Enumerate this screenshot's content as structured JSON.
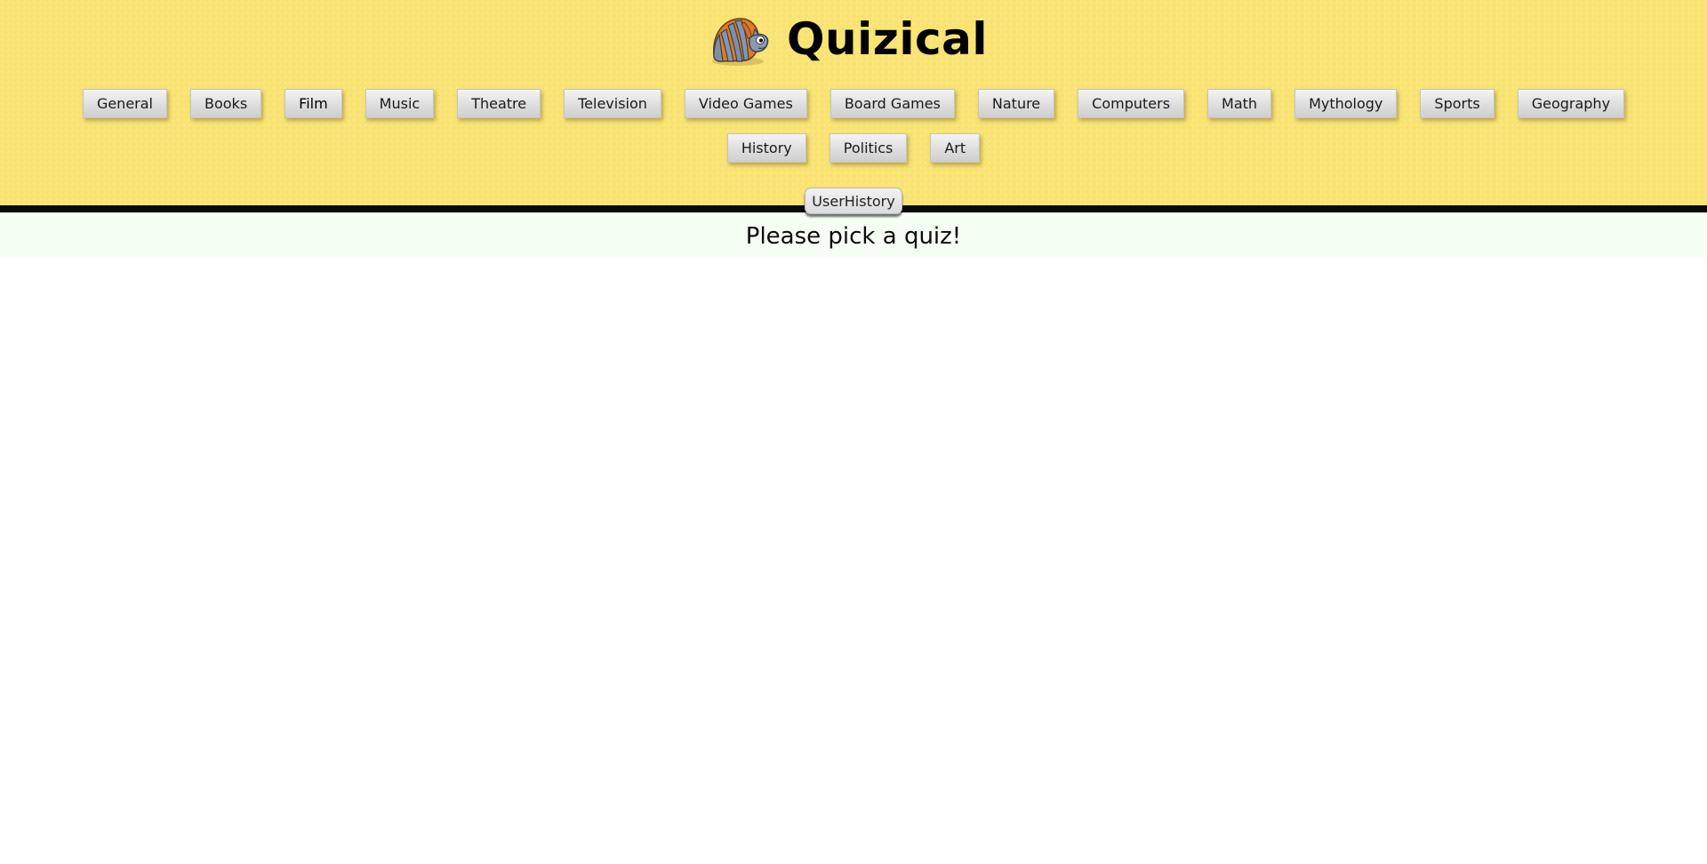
{
  "brand": {
    "title": "Quizical",
    "logo_icon": "armadillo-logo-icon"
  },
  "categories": [
    {
      "label": "General"
    },
    {
      "label": "Books"
    },
    {
      "label": "Film"
    },
    {
      "label": "Music"
    },
    {
      "label": "Theatre"
    },
    {
      "label": "Television"
    },
    {
      "label": "Video Games"
    },
    {
      "label": "Board Games"
    },
    {
      "label": "Nature"
    },
    {
      "label": "Computers"
    },
    {
      "label": "Math"
    },
    {
      "label": "Mythology"
    },
    {
      "label": "Sports"
    },
    {
      "label": "Geography"
    },
    {
      "label": "History"
    },
    {
      "label": "Politics"
    },
    {
      "label": "Art"
    }
  ],
  "history_button": {
    "label": "UserHistory"
  },
  "main": {
    "prompt": "Please pick a quiz!"
  },
  "colors": {
    "header_bg": "#f9e473",
    "divider": "#0a0a0a",
    "prompt_bg": "#f6fff4",
    "button_face": "#dedede"
  }
}
